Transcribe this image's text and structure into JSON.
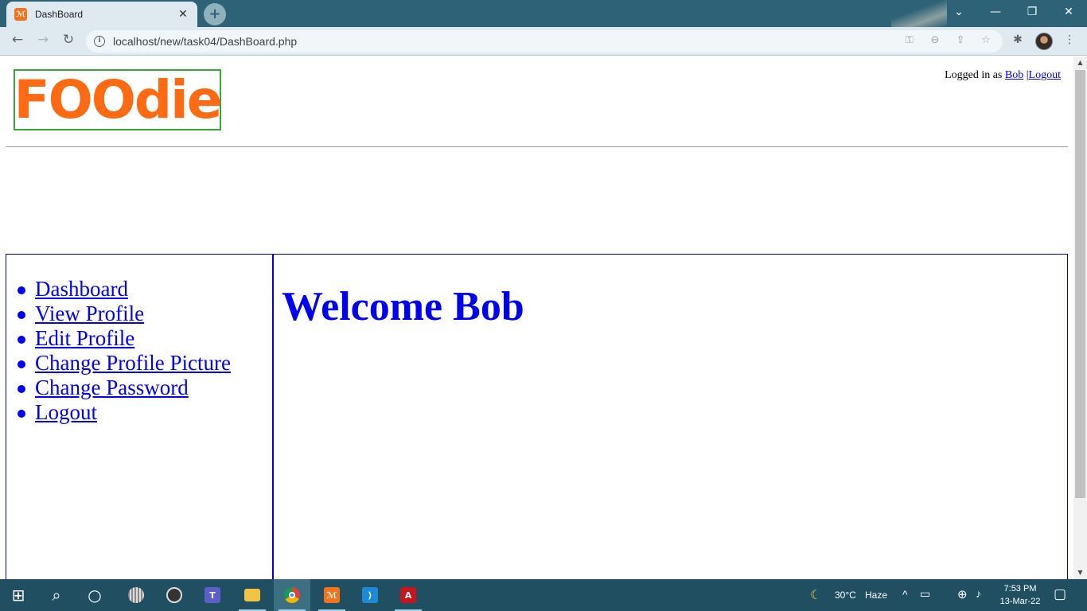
{
  "browser": {
    "tab": {
      "favicon_glyph": "ℳ",
      "title": "DashBoard",
      "close_glyph": "✕"
    },
    "new_tab_glyph": "+",
    "window_controls": {
      "minimize": "—",
      "restore": "❐",
      "close": "✕",
      "dropdown": "⌄"
    },
    "nav": {
      "back": "←",
      "forward": "→",
      "reload": "↻"
    },
    "address": {
      "url": "localhost/new/task04/DashBoard.php",
      "info_glyph": "i"
    },
    "omnibox_icons": {
      "key": "⚿",
      "zoom": "⊖",
      "share": "⇪",
      "bookmark": "☆"
    },
    "toolbar_icons": {
      "extensions": "✱",
      "menu": "⋮"
    }
  },
  "page": {
    "logo_text": "FOOdie",
    "login": {
      "prefix": "Logged in as ",
      "user": "Bob",
      "separator": " |",
      "logout": "Logout"
    },
    "sidebar": {
      "items": [
        {
          "label": "Dashboard"
        },
        {
          "label": "View Profile"
        },
        {
          "label": "Edit Profile"
        },
        {
          "label": "Change Profile Picture"
        },
        {
          "label": "Change Password"
        },
        {
          "label": "Logout"
        }
      ]
    },
    "main": {
      "heading": "Welcome Bob"
    }
  },
  "scrollbar": {
    "up": "▲",
    "down": "▼"
  },
  "taskbar": {
    "start_glyph": "⊞",
    "search_glyph": "⌕",
    "cortana_glyph": "○",
    "apps": {
      "xampp_glyph": "ℳ",
      "vscode_glyph": "⟩",
      "acrobat_glyph": "A"
    },
    "weather": {
      "icon": "☾",
      "temp": "30°C",
      "condition": "Haze"
    },
    "tray": {
      "chevron": "^",
      "battery": "▭",
      "network": "⊕",
      "volume": "♪",
      "notification": "▢"
    },
    "clock": {
      "time": "7:53 PM",
      "date": "13-Mar-22"
    }
  }
}
